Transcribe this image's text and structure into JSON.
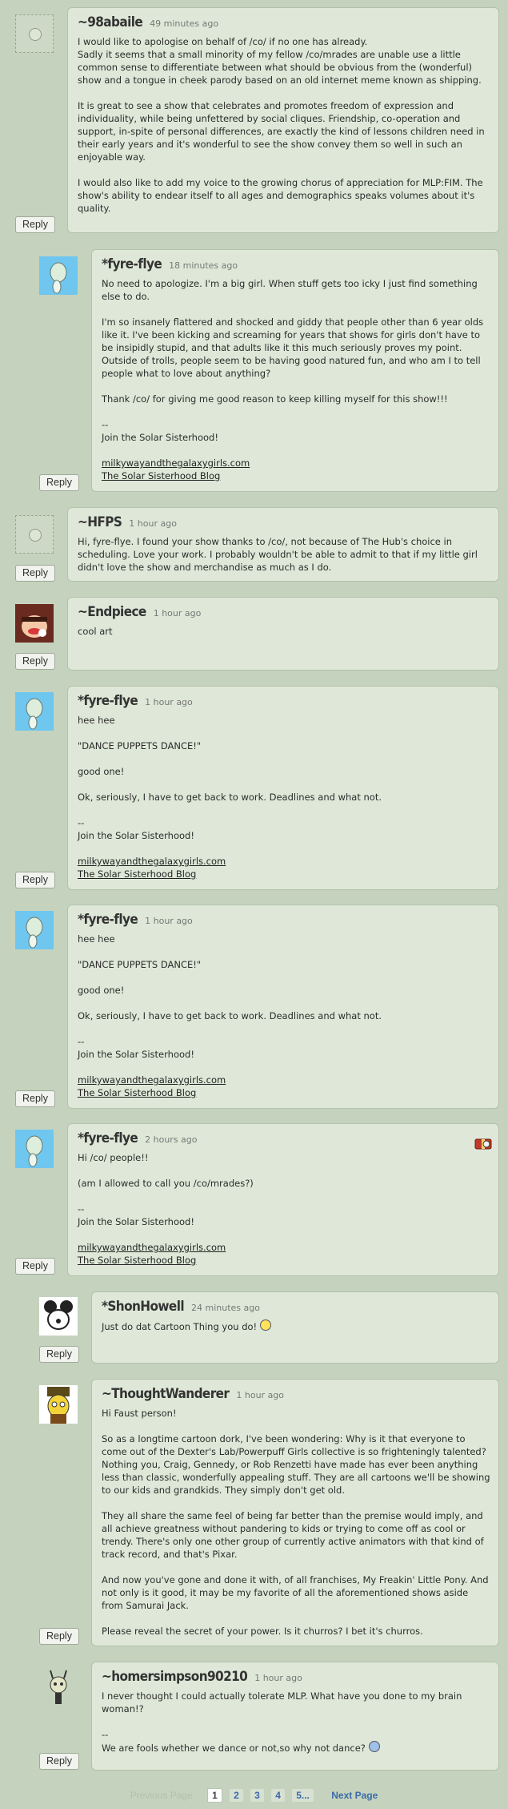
{
  "reply_label": "Reply",
  "comments": [
    {
      "username": "~98abaile",
      "timestamp": "49 minutes ago",
      "paragraphs": [
        "I would like to apologise on behalf of /co/ if no one has already.\nSadly it seems that a small minority of my fellow /co/mrades are unable use a little common sense to differentiate between what should be obvious from the (wonderful) show and a tongue in cheek parody based on an old internet meme known as shipping.",
        "It is great to see a show that celebrates and promotes freedom of expression and individuality, while being unfettered by social cliques. Friendship, co-operation and support, in-spite of personal differences, are exactly the kind of lessons children need in their early years and it's wonderful to see the show convey them so well in such an enjoyable way.",
        "I would also like to add my voice to the growing chorus of appreciation for MLP:FIM. The show's ability to endear itself to all ages and demographics speaks volumes about it's quality."
      ]
    },
    {
      "username": "*fyre-flye",
      "timestamp": "18 minutes ago",
      "paragraphs": [
        "No need to apologize. I'm a big girl. When stuff gets too icky I just find something else to do.",
        "I'm so insanely flattered and shocked and giddy that people other than 6 year olds like it. I've been kicking and screaming for years that shows for girls don't have to be insipidly stupid, and that adults like it this much seriously proves my point. Outside of trolls, people seem to be having good natured fun, and who am I to tell people what to love about anything?",
        "Thank /co/ for giving me good reason to keep killing myself for this show!!!",
        "--\nJoin the Solar Sisterhood!"
      ],
      "links": [
        "milkywayandthegalaxygirls.com",
        "The Solar Sisterhood Blog"
      ]
    },
    {
      "username": "~HFPS",
      "timestamp": "1 hour ago",
      "paragraphs": [
        "Hi, fyre-flye. I found your show thanks to /co/, not because of The Hub's choice in scheduling. Love your work. I probably wouldn't be able to admit to that if my little girl didn't love the show and merchandise as much as I do."
      ]
    },
    {
      "username": "~Endpiece",
      "timestamp": "1 hour ago",
      "paragraphs": [
        "cool art"
      ]
    },
    {
      "username": "*fyre-flye",
      "timestamp": "1 hour ago",
      "paragraphs": [
        "hee hee",
        "\"DANCE PUPPETS DANCE!\"",
        "good one!",
        "Ok, seriously, I have to get back to work. Deadlines and what not.",
        "--\nJoin the Solar Sisterhood!"
      ],
      "links": [
        "milkywayandthegalaxygirls.com",
        "The Solar Sisterhood Blog"
      ]
    },
    {
      "username": "*fyre-flye",
      "timestamp": "1 hour ago",
      "paragraphs": [
        "hee hee",
        "\"DANCE PUPPETS DANCE!\"",
        "good one!",
        "Ok, seriously, I have to get back to work. Deadlines and what not.",
        "--\nJoin the Solar Sisterhood!"
      ],
      "links": [
        "milkywayandthegalaxygirls.com",
        "The Solar Sisterhood Blog"
      ]
    },
    {
      "username": "*fyre-flye",
      "timestamp": "2 hours ago",
      "paragraphs": [
        "Hi /co/ people!!",
        "(am I allowed to call you /co/mrades?)",
        "--\nJoin the Solar Sisterhood!"
      ],
      "links": [
        "milkywayandthegalaxygirls.com",
        "The Solar Sisterhood Blog"
      ]
    },
    {
      "username": "*ShonHowell",
      "timestamp": "24 minutes ago",
      "paragraphs": [
        "Just do dat Cartoon Thing you do!"
      ]
    },
    {
      "username": "~ThoughtWanderer",
      "timestamp": "1 hour ago",
      "paragraphs": [
        "Hi Faust person!",
        "So as a longtime cartoon dork, I've been wondering: Why is it that everyone to come out of the Dexter's Lab/Powerpuff Girls collective is so frighteningly talented? Nothing you, Craig, Gennedy, or Rob Renzetti have made has ever been anything less than classic, wonderfully appealing stuff. They are all cartoons we'll be showing to our kids and grandkids. They simply don't get old.",
        "They all share the same feel of being far better than the premise would imply, and all achieve greatness without pandering to kids or trying to come off as cool or trendy. There's only one other group of currently active animators with that kind of track record, and that's Pixar.",
        "And now you've gone and done it with, of all franchises, My Freakin' Little Pony. And not only is it good, it may be my favorite of all the aforementioned shows aside from Samurai Jack.",
        "Please reveal the secret of your power. Is it churros? I bet it's churros."
      ]
    },
    {
      "username": "~homersimpson90210",
      "timestamp": "1 hour ago",
      "paragraphs": [
        "I never thought I could actually tolerate MLP. What have you done to my brain woman!?",
        "--\nWe are fools whether we dance or not,so why not dance?"
      ]
    }
  ],
  "pagination": {
    "prev_label": "Previous Page",
    "pages": [
      "1",
      "2",
      "3",
      "4",
      "5..."
    ],
    "current": "1",
    "next_label": "Next Page"
  }
}
